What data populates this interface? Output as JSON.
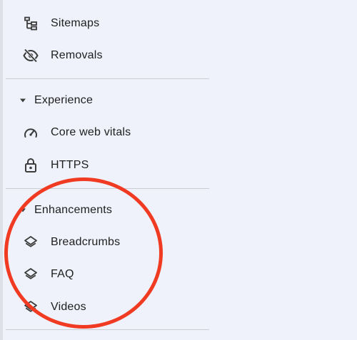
{
  "nav": {
    "top_items": [
      {
        "label": "Sitemaps",
        "icon": "sitemap-icon"
      },
      {
        "label": "Removals",
        "icon": "eye-off-icon"
      }
    ],
    "experience": {
      "label": "Experience",
      "items": [
        {
          "label": "Core web vitals",
          "icon": "speed-gauge-icon"
        },
        {
          "label": "HTTPS",
          "icon": "lock-icon"
        }
      ]
    },
    "enhancements": {
      "label": "Enhancements",
      "items": [
        {
          "label": "Breadcrumbs",
          "icon": "layers-icon"
        },
        {
          "label": "FAQ",
          "icon": "layers-icon"
        },
        {
          "label": "Videos",
          "icon": "layers-icon"
        }
      ]
    }
  },
  "annotation": {
    "color": "#f03a22",
    "shape": "circle"
  },
  "colors": {
    "background": "#eff2fa",
    "text": "#1f1f1f",
    "icon": "#3c3c3c",
    "divider": "#c9ccd1"
  }
}
